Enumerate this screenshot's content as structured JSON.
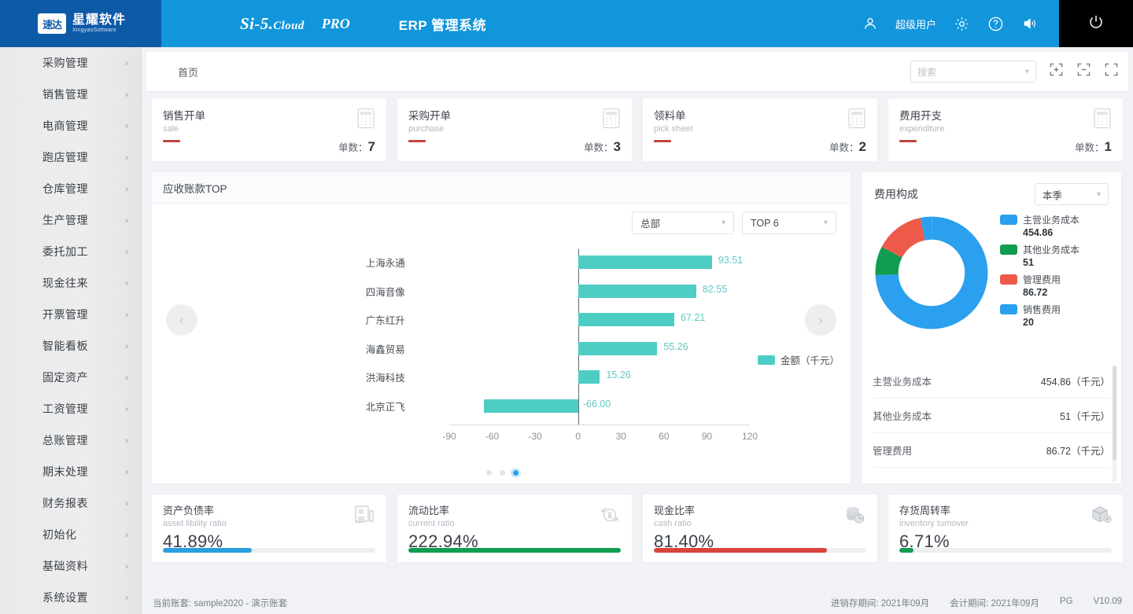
{
  "colors": {
    "brand_dark_blue": "#0d5aa7",
    "brand_blue": "#1296db",
    "teal": "#4ecdc4",
    "green": "#0f9d4f",
    "red": "#d8453a",
    "blue": "#2aa0ee",
    "dark_red": "#c0453c"
  },
  "topbar": {
    "logo_cn": "星耀软件",
    "logo_en": "XingyaoSoftware",
    "logo_mark": "速达",
    "product_name": "Si-5.",
    "product_suffix": "Cloud",
    "product_edition": "PRO",
    "system_name": "ERP 管理系统",
    "user_name": "超级用户",
    "icons": {
      "user": "user-icon",
      "gear": "gear-icon",
      "help": "help-icon",
      "sound": "sound-icon",
      "power": "power-icon"
    }
  },
  "sidebar": {
    "items": [
      {
        "label": "采购管理"
      },
      {
        "label": "销售管理"
      },
      {
        "label": "电商管理"
      },
      {
        "label": "跑店管理"
      },
      {
        "label": "仓库管理"
      },
      {
        "label": "生产管理"
      },
      {
        "label": "委托加工"
      },
      {
        "label": "现金往来"
      },
      {
        "label": "开票管理"
      },
      {
        "label": "智能看板"
      },
      {
        "label": "固定资产"
      },
      {
        "label": "工资管理"
      },
      {
        "label": "总账管理"
      },
      {
        "label": "期末处理"
      },
      {
        "label": "财务报表"
      },
      {
        "label": "初始化"
      },
      {
        "label": "基础资料"
      },
      {
        "label": "系统设置"
      }
    ],
    "arrow": "›"
  },
  "crumbbar": {
    "breadcrumb": "首页",
    "search_placeholder": "搜索",
    "icons": [
      "expand-plus-icon",
      "collapse-icon",
      "fullscreen-icon"
    ]
  },
  "stat_cards": [
    {
      "cn": "销售开单",
      "en": "sale",
      "count_label": "单数：",
      "count": "7"
    },
    {
      "cn": "采购开单",
      "en": "purchase",
      "count_label": "单数：",
      "count": "3"
    },
    {
      "cn": "领料单",
      "en": "pick sheet",
      "count_label": "单数：",
      "count": "2"
    },
    {
      "cn": "费用开支",
      "en": "expenditure",
      "count_label": "单数：",
      "count": "1"
    }
  ],
  "chart_panel": {
    "title": "应收账款TOP",
    "filter_org": "总部",
    "filter_top": "TOP 6",
    "prev_arrow": "‹",
    "next_arrow": "›",
    "dots_total": 3,
    "active_dot": 3
  },
  "expense_panel": {
    "title": "费用构成",
    "period": "本季",
    "list": [
      {
        "name": "主营业务成本",
        "value": "454.86（千元）"
      },
      {
        "name": "其他业务成本",
        "value": "51（千元）"
      },
      {
        "name": "管理费用",
        "value": "86.72（千元）"
      }
    ]
  },
  "ratio_cards": [
    {
      "cn": "资产负债率",
      "en": "asset libility ratio",
      "value": "41.89%",
      "pct": 41.89,
      "color": "#2a9fe0",
      "icon": "report-chart-icon"
    },
    {
      "cn": "流动比率",
      "en": "current ratio",
      "value": "222.94%",
      "pct": 100,
      "color": "#0f9d4f",
      "icon": "currency-cycle-icon"
    },
    {
      "cn": "现金比率",
      "en": "cash ratio",
      "value": "81.40%",
      "pct": 81.4,
      "color": "#d8453a",
      "icon": "coins-pie-icon"
    },
    {
      "cn": "存货周转率",
      "en": "inventory turnover",
      "value": "6.71%",
      "pct": 6.71,
      "color": "#0f9d4f",
      "icon": "box-cube-icon"
    }
  ],
  "footer": {
    "account": "当前账套: sample2020 - 演示账套",
    "inventory_period": "进销存期间: 2021年09月",
    "accounting_period": "会计期间: 2021年09月",
    "pg": "PG",
    "version": "V10.09"
  },
  "chart_data": [
    {
      "type": "bar",
      "orientation": "horizontal",
      "title": "应收账款TOP",
      "categories": [
        "上海永通",
        "四海音像",
        "广东红升",
        "海鑫贸易",
        "洪海科技",
        "北京正飞"
      ],
      "values": [
        93.51,
        82.55,
        67.21,
        55.26,
        15.26,
        -66.0
      ],
      "data_labels": [
        "93.51",
        "82.55",
        "67.21",
        "55.26",
        "15.26",
        "-66.00"
      ],
      "series": [
        {
          "name": "金额（千元）",
          "values": [
            93.51,
            82.55,
            67.21,
            55.26,
            15.26,
            -66.0
          ]
        }
      ],
      "legend": [
        "金额（千元）"
      ],
      "legend_position": "right",
      "xlabel": "",
      "ylabel": "",
      "xlim": [
        -90,
        120
      ],
      "xticks": [
        -90,
        -60,
        -30,
        0,
        30,
        60,
        90,
        120
      ],
      "xtick_labels": [
        "-90",
        "-60",
        "-30",
        "0",
        "30",
        "60",
        "90",
        "120"
      ],
      "grid": false,
      "bar_color": "#4ecdc4"
    },
    {
      "type": "pie",
      "variant": "donut",
      "title": "费用构成",
      "labels": [
        "主营业务成本",
        "其他业务成本",
        "管理费用",
        "销售费用"
      ],
      "values": [
        454.86,
        51,
        86.72,
        20
      ],
      "value_labels": [
        "454.86",
        "51",
        "86.72",
        "20"
      ],
      "colors": [
        "#2aa0ee",
        "#0f9d4f",
        "#ed5a4a",
        "#2aa0ee"
      ],
      "legend_position": "right",
      "unit": "千元"
    }
  ]
}
